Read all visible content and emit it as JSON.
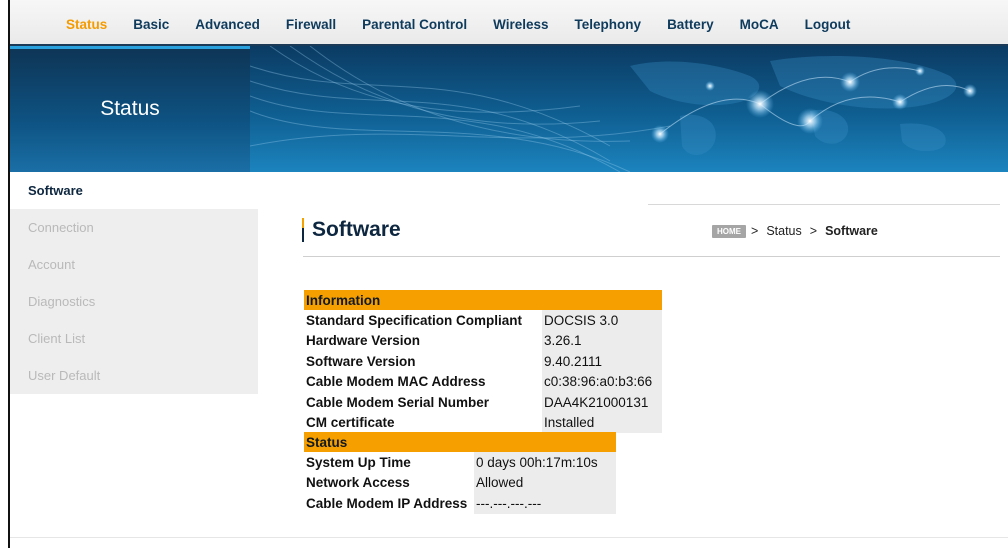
{
  "nav": {
    "items": [
      "Status",
      "Basic",
      "Advanced",
      "Firewall",
      "Parental Control",
      "Wireless",
      "Telephony",
      "Battery",
      "MoCA",
      "Logout"
    ],
    "active_index": 0
  },
  "banner": {
    "title": "Status"
  },
  "sidebar": {
    "items": [
      {
        "label": "Software",
        "active": true
      },
      {
        "label": "Connection",
        "active": false
      },
      {
        "label": "Account",
        "active": false
      },
      {
        "label": "Diagnostics",
        "active": false
      },
      {
        "label": "Client List",
        "active": false
      },
      {
        "label": "User Default",
        "active": false
      }
    ]
  },
  "page": {
    "title": "Software"
  },
  "breadcrumb": {
    "home_label": "HOME",
    "sep1": ">",
    "level1": "Status",
    "sep2": ">",
    "current": "Software"
  },
  "information": {
    "header": "Information",
    "rows": [
      {
        "label": "Standard Specification Compliant",
        "value": "DOCSIS 3.0"
      },
      {
        "label": "Hardware Version",
        "value": "3.26.1"
      },
      {
        "label": "Software Version",
        "value": "9.40.2111"
      },
      {
        "label": "Cable Modem MAC Address",
        "value": "c0:38:96:a0:b3:66"
      },
      {
        "label": "Cable Modem Serial Number",
        "value": "DAA4K21000131"
      },
      {
        "label": "CM certificate",
        "value": "Installed"
      }
    ]
  },
  "status": {
    "header": "Status",
    "rows": [
      {
        "label": "System Up Time",
        "value": "0 days 00h:17m:10s"
      },
      {
        "label": "Network Access",
        "value": "Allowed"
      },
      {
        "label": "Cable Modem IP Address",
        "value": "---.---.---.---"
      }
    ]
  },
  "colors": {
    "accent": "#f5a000",
    "nav_text": "#0e3a5c",
    "banner": "#0f5f92"
  }
}
